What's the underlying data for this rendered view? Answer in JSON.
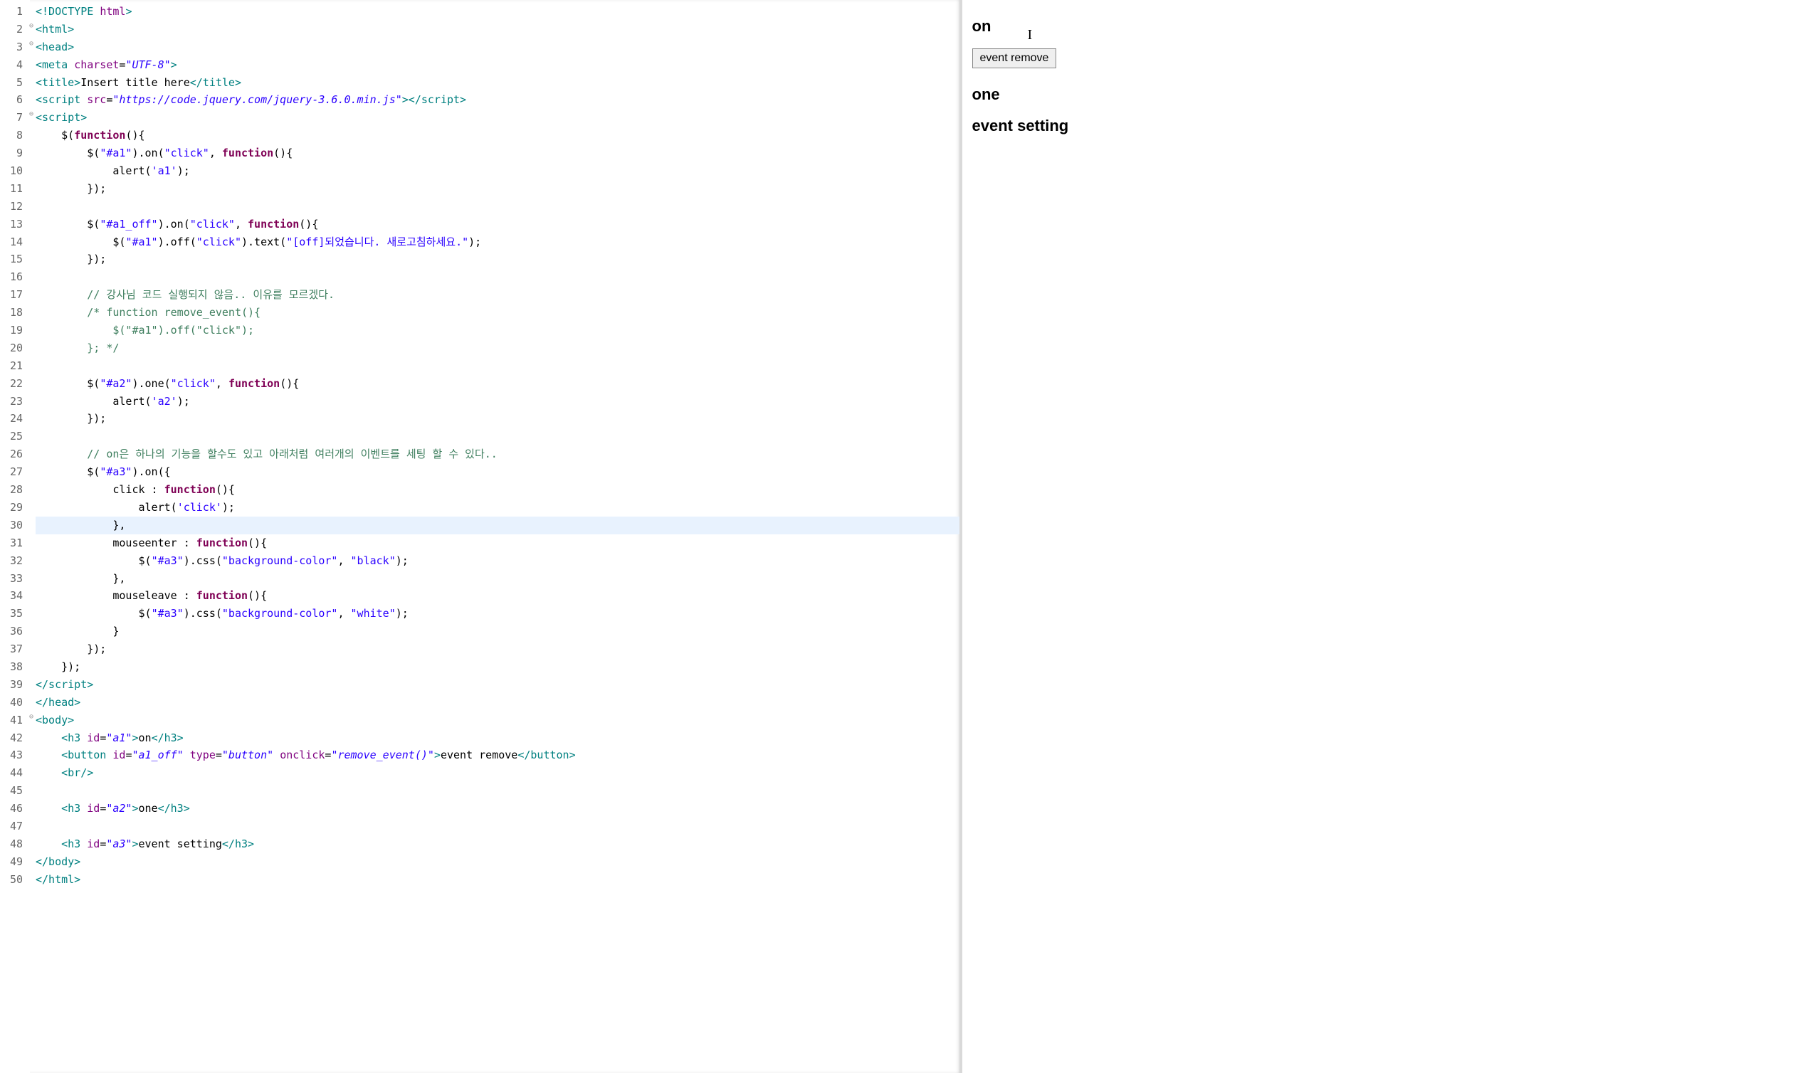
{
  "editor": {
    "highlighted_line": 30,
    "fold_lines": [
      2,
      3,
      7,
      41
    ],
    "lines": [
      {
        "n": 1,
        "t": [
          [
            "tag",
            "<!DOCTYPE"
          ],
          [
            "txt",
            " "
          ],
          [
            "attr",
            "html"
          ],
          [
            "tag",
            ">"
          ]
        ]
      },
      {
        "n": 2,
        "t": [
          [
            "tag",
            "<html>"
          ]
        ]
      },
      {
        "n": 3,
        "t": [
          [
            "tag",
            "<head>"
          ]
        ]
      },
      {
        "n": 4,
        "t": [
          [
            "tag",
            "<meta"
          ],
          [
            "txt",
            " "
          ],
          [
            "attr",
            "charset"
          ],
          [
            "txt",
            "="
          ],
          [
            "attrval",
            "\"UTF-8\""
          ],
          [
            "tag",
            ">"
          ]
        ]
      },
      {
        "n": 5,
        "t": [
          [
            "tag",
            "<title>"
          ],
          [
            "txt",
            "Insert title here"
          ],
          [
            "tag",
            "</title>"
          ]
        ]
      },
      {
        "n": 6,
        "t": [
          [
            "tag",
            "<script"
          ],
          [
            "txt",
            " "
          ],
          [
            "attr",
            "src"
          ],
          [
            "txt",
            "="
          ],
          [
            "attrval",
            "\"https://code.jquery.com/jquery-3.6.0.min.js\""
          ],
          [
            "tag",
            ">"
          ],
          [
            "tag",
            "</script>"
          ]
        ]
      },
      {
        "n": 7,
        "t": [
          [
            "tag",
            "<script>"
          ]
        ]
      },
      {
        "n": 8,
        "t": [
          [
            "txt",
            "    $("
          ],
          [
            "kw",
            "function"
          ],
          [
            "txt",
            "(){"
          ]
        ]
      },
      {
        "n": 9,
        "t": [
          [
            "txt",
            "        $("
          ],
          [
            "str",
            "\"#a1\""
          ],
          [
            "txt",
            ").on("
          ],
          [
            "str",
            "\"click\""
          ],
          [
            "txt",
            ", "
          ],
          [
            "kw",
            "function"
          ],
          [
            "txt",
            "(){"
          ]
        ]
      },
      {
        "n": 10,
        "t": [
          [
            "txt",
            "            alert("
          ],
          [
            "str",
            "'a1'"
          ],
          [
            "txt",
            ");"
          ]
        ]
      },
      {
        "n": 11,
        "t": [
          [
            "txt",
            "        });"
          ]
        ]
      },
      {
        "n": 12,
        "t": [
          [
            "txt",
            ""
          ]
        ]
      },
      {
        "n": 13,
        "t": [
          [
            "txt",
            "        $("
          ],
          [
            "str",
            "\"#a1_off\""
          ],
          [
            "txt",
            ").on("
          ],
          [
            "str",
            "\"click\""
          ],
          [
            "txt",
            ", "
          ],
          [
            "kw",
            "function"
          ],
          [
            "txt",
            "(){"
          ]
        ]
      },
      {
        "n": 14,
        "t": [
          [
            "txt",
            "            $("
          ],
          [
            "str",
            "\"#a1\""
          ],
          [
            "txt",
            ").off("
          ],
          [
            "str",
            "\"click\""
          ],
          [
            "txt",
            ").text("
          ],
          [
            "str",
            "\"[off]되었습니다. 새로고침하세요.\""
          ],
          [
            "txt",
            ");"
          ]
        ]
      },
      {
        "n": 15,
        "t": [
          [
            "txt",
            "        });"
          ]
        ]
      },
      {
        "n": 16,
        "t": [
          [
            "txt",
            ""
          ]
        ]
      },
      {
        "n": 17,
        "t": [
          [
            "txt",
            "        "
          ],
          [
            "cmt",
            "// 강사님 코드 실행되지 않음.. 이유를 모르겠다."
          ]
        ]
      },
      {
        "n": 18,
        "t": [
          [
            "txt",
            "        "
          ],
          [
            "cmt",
            "/* function remove_event(){"
          ]
        ]
      },
      {
        "n": 19,
        "t": [
          [
            "txt",
            "            "
          ],
          [
            "cmt",
            "$(\"#a1\").off(\"click\");"
          ]
        ]
      },
      {
        "n": 20,
        "t": [
          [
            "txt",
            "        "
          ],
          [
            "cmt",
            "}; */"
          ]
        ]
      },
      {
        "n": 21,
        "t": [
          [
            "txt",
            ""
          ]
        ]
      },
      {
        "n": 22,
        "t": [
          [
            "txt",
            "        $("
          ],
          [
            "str",
            "\"#a2\""
          ],
          [
            "txt",
            ").one("
          ],
          [
            "str",
            "\"click\""
          ],
          [
            "txt",
            ", "
          ],
          [
            "kw",
            "function"
          ],
          [
            "txt",
            "(){"
          ]
        ]
      },
      {
        "n": 23,
        "t": [
          [
            "txt",
            "            alert("
          ],
          [
            "str",
            "'a2'"
          ],
          [
            "txt",
            ");"
          ]
        ]
      },
      {
        "n": 24,
        "t": [
          [
            "txt",
            "        });"
          ]
        ]
      },
      {
        "n": 25,
        "t": [
          [
            "txt",
            ""
          ]
        ]
      },
      {
        "n": 26,
        "t": [
          [
            "txt",
            "        "
          ],
          [
            "cmt",
            "// on은 하나의 기능을 할수도 있고 아래처럼 여러개의 이벤트를 세팅 할 수 있다.."
          ]
        ]
      },
      {
        "n": 27,
        "t": [
          [
            "txt",
            "        $("
          ],
          [
            "str",
            "\"#a3\""
          ],
          [
            "txt",
            ").on({"
          ]
        ]
      },
      {
        "n": 28,
        "t": [
          [
            "txt",
            "            click : "
          ],
          [
            "kw",
            "function"
          ],
          [
            "txt",
            "(){"
          ]
        ]
      },
      {
        "n": 29,
        "t": [
          [
            "txt",
            "                alert("
          ],
          [
            "str",
            "'click'"
          ],
          [
            "txt",
            ");"
          ]
        ]
      },
      {
        "n": 30,
        "t": [
          [
            "txt",
            "            },"
          ]
        ]
      },
      {
        "n": 31,
        "t": [
          [
            "txt",
            "            mouseenter : "
          ],
          [
            "kw",
            "function"
          ],
          [
            "txt",
            "(){"
          ]
        ]
      },
      {
        "n": 32,
        "t": [
          [
            "txt",
            "                $("
          ],
          [
            "str",
            "\"#a3\""
          ],
          [
            "txt",
            ").css("
          ],
          [
            "str",
            "\"background-color\""
          ],
          [
            "txt",
            ", "
          ],
          [
            "str",
            "\"black\""
          ],
          [
            "txt",
            ");"
          ]
        ]
      },
      {
        "n": 33,
        "t": [
          [
            "txt",
            "            },"
          ]
        ]
      },
      {
        "n": 34,
        "t": [
          [
            "txt",
            "            mouseleave : "
          ],
          [
            "kw",
            "function"
          ],
          [
            "txt",
            "(){"
          ]
        ]
      },
      {
        "n": 35,
        "t": [
          [
            "txt",
            "                $("
          ],
          [
            "str",
            "\"#a3\""
          ],
          [
            "txt",
            ").css("
          ],
          [
            "str",
            "\"background-color\""
          ],
          [
            "txt",
            ", "
          ],
          [
            "str",
            "\"white\""
          ],
          [
            "txt",
            ");"
          ]
        ]
      },
      {
        "n": 36,
        "t": [
          [
            "txt",
            "            }"
          ]
        ]
      },
      {
        "n": 37,
        "t": [
          [
            "txt",
            "        });"
          ]
        ]
      },
      {
        "n": 38,
        "t": [
          [
            "txt",
            "    });"
          ]
        ]
      },
      {
        "n": 39,
        "t": [
          [
            "tag",
            "</script>"
          ]
        ]
      },
      {
        "n": 40,
        "t": [
          [
            "tag",
            "</head>"
          ]
        ]
      },
      {
        "n": 41,
        "t": [
          [
            "tag",
            "<body>"
          ]
        ]
      },
      {
        "n": 42,
        "t": [
          [
            "txt",
            "    "
          ],
          [
            "tag",
            "<h3"
          ],
          [
            "txt",
            " "
          ],
          [
            "attr",
            "id"
          ],
          [
            "txt",
            "="
          ],
          [
            "attrval",
            "\"a1\""
          ],
          [
            "tag",
            ">"
          ],
          [
            "txt",
            "on"
          ],
          [
            "tag",
            "</h3>"
          ]
        ]
      },
      {
        "n": 43,
        "t": [
          [
            "txt",
            "    "
          ],
          [
            "tag",
            "<button"
          ],
          [
            "txt",
            " "
          ],
          [
            "attr",
            "id"
          ],
          [
            "txt",
            "="
          ],
          [
            "attrval",
            "\"a1_off\""
          ],
          [
            "txt",
            " "
          ],
          [
            "attr",
            "type"
          ],
          [
            "txt",
            "="
          ],
          [
            "attrval",
            "\"button\""
          ],
          [
            "txt",
            " "
          ],
          [
            "attr",
            "onclick"
          ],
          [
            "txt",
            "="
          ],
          [
            "attrval",
            "\"remove_event()\""
          ],
          [
            "tag",
            ">"
          ],
          [
            "txt",
            "event remove"
          ],
          [
            "tag",
            "</button>"
          ]
        ]
      },
      {
        "n": 44,
        "t": [
          [
            "txt",
            "    "
          ],
          [
            "tag",
            "<br/>"
          ]
        ]
      },
      {
        "n": 45,
        "t": [
          [
            "txt",
            ""
          ]
        ]
      },
      {
        "n": 46,
        "t": [
          [
            "txt",
            "    "
          ],
          [
            "tag",
            "<h3"
          ],
          [
            "txt",
            " "
          ],
          [
            "attr",
            "id"
          ],
          [
            "txt",
            "="
          ],
          [
            "attrval",
            "\"a2\""
          ],
          [
            "tag",
            ">"
          ],
          [
            "txt",
            "one"
          ],
          [
            "tag",
            "</h3>"
          ]
        ]
      },
      {
        "n": 47,
        "t": [
          [
            "txt",
            ""
          ]
        ]
      },
      {
        "n": 48,
        "t": [
          [
            "txt",
            "    "
          ],
          [
            "tag",
            "<h3"
          ],
          [
            "txt",
            " "
          ],
          [
            "attr",
            "id"
          ],
          [
            "txt",
            "="
          ],
          [
            "attrval",
            "\"a3\""
          ],
          [
            "tag",
            ">"
          ],
          [
            "txt",
            "event setting"
          ],
          [
            "tag",
            "</h3>"
          ]
        ]
      },
      {
        "n": 49,
        "t": [
          [
            "tag",
            "</body>"
          ]
        ]
      },
      {
        "n": 50,
        "t": [
          [
            "tag",
            "</html>"
          ]
        ]
      }
    ]
  },
  "preview": {
    "h_on": "on",
    "button_label": "event remove",
    "h_one": "one",
    "h_event_setting": "event setting",
    "caret_glyph": "I"
  }
}
